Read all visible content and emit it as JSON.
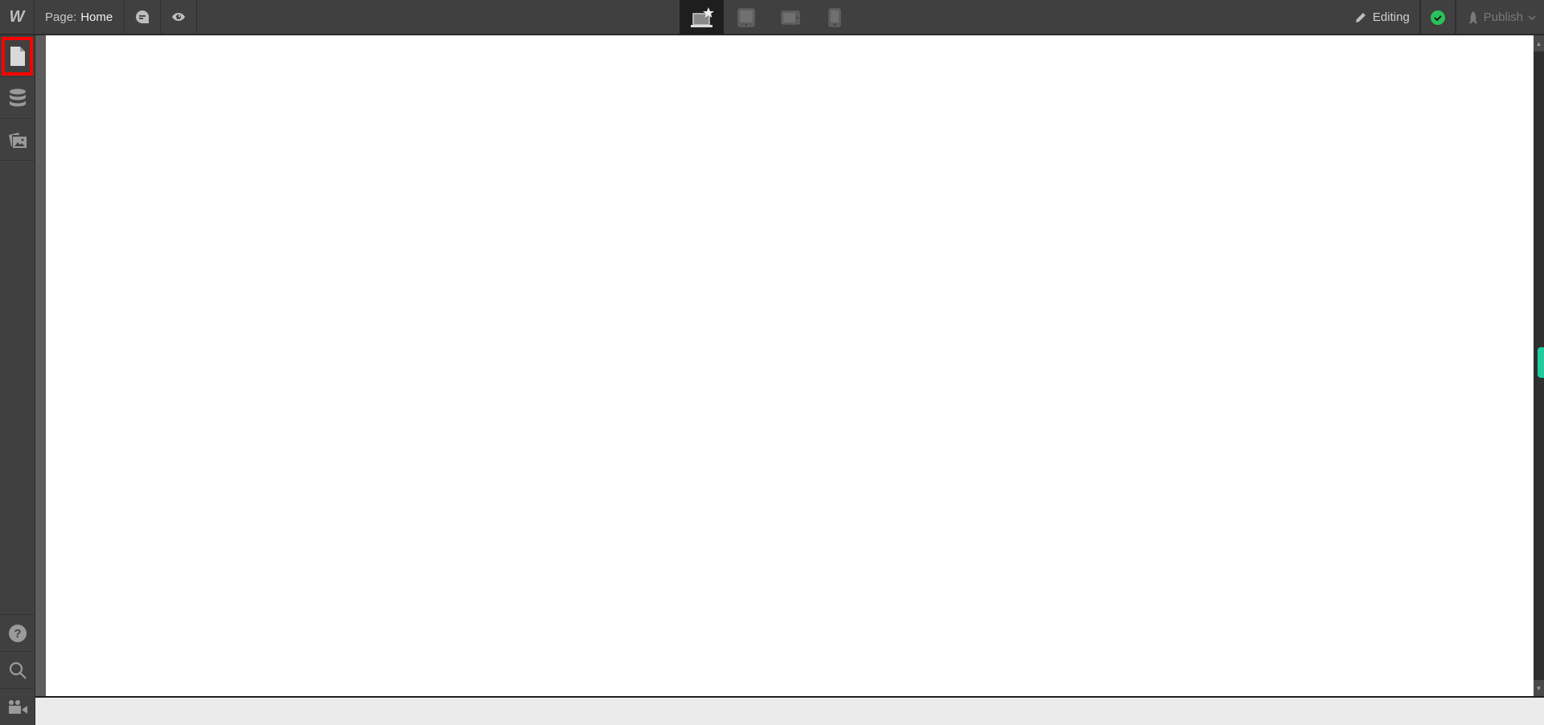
{
  "topbar": {
    "logo": "W",
    "page_prefix": "Page:",
    "page_name": "Home",
    "comments_icon": "comment-icon",
    "preview_icon": "eye-icon",
    "devices": [
      {
        "name": "desktop-base",
        "icon": "laptop-star-icon",
        "active": true
      },
      {
        "name": "tablet",
        "icon": "tablet-icon",
        "active": false
      },
      {
        "name": "mobile-landscape",
        "icon": "phone-landscape-icon",
        "active": false
      },
      {
        "name": "mobile-portrait",
        "icon": "phone-portrait-icon",
        "active": false
      }
    ],
    "mode_label": "Editing",
    "status": "saved",
    "status_color": "#2ac25a",
    "publish_label": "Publish"
  },
  "sidebar": {
    "top_items": [
      {
        "name": "pages",
        "icon": "page-icon",
        "active": true
      },
      {
        "name": "cms",
        "icon": "database-icon",
        "active": false
      },
      {
        "name": "assets",
        "icon": "images-icon",
        "active": false
      }
    ],
    "bottom_items": [
      {
        "name": "help",
        "icon": "help-icon"
      },
      {
        "name": "search",
        "icon": "search-icon"
      },
      {
        "name": "video-tutorials",
        "icon": "video-camera-icon"
      }
    ]
  },
  "colors": {
    "accent": "#1fcc9f",
    "highlight": "#ff0000"
  }
}
